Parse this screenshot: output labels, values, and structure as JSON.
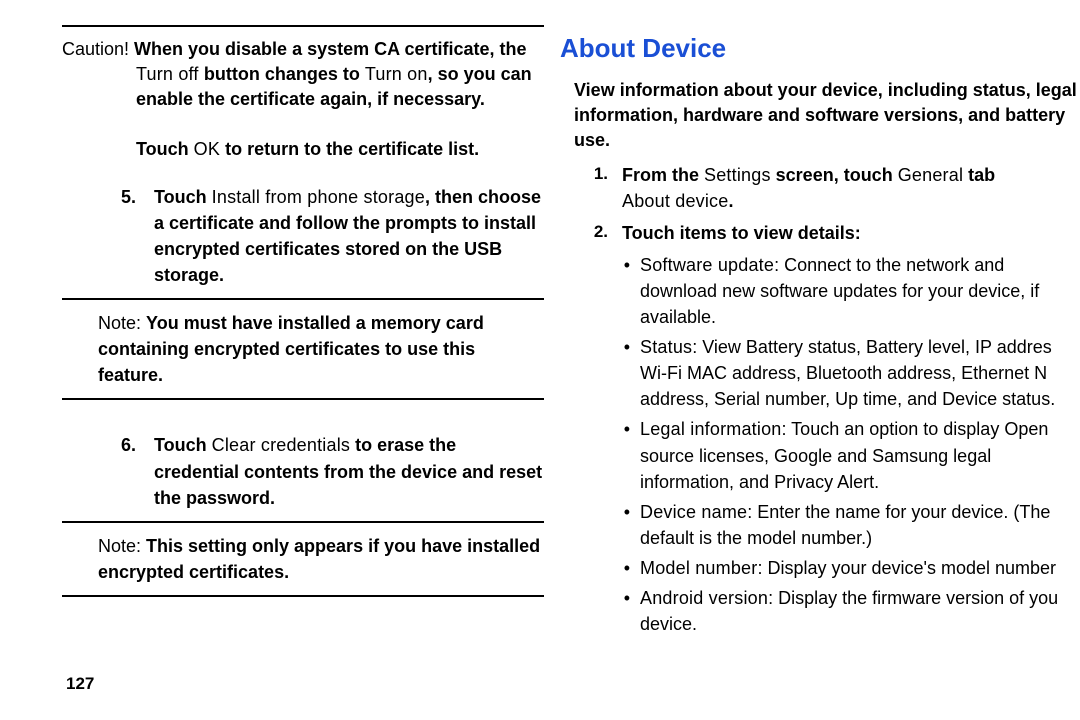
{
  "left": {
    "caution_label": "Caution! ",
    "caution_l1a": "When you disable a system CA certificate, the",
    "caution_l2a": "Turn off ",
    "caution_l2b": "button changes to ",
    "caution_l2c": "Turn on",
    "caution_l2d": ", so you can",
    "caution_l3": "enable the certificate again, if necessary.",
    "touch_ok_pre": "Touch ",
    "touch_ok_mid": "OK",
    "touch_ok_post": " to return to the certificate list.",
    "step5_num": "5.",
    "step5_a": "Touch ",
    "step5_b": "Install from phone storage",
    "step5_c": ", then choose a certificate and follow the prompts to install encrypted certificates stored on the USB storage.",
    "note1_lbl": "Note: ",
    "note1_txt": "You must have installed a memory card containing encrypted certificates to use this feature.",
    "step6_num": "6.",
    "step6_a": "Touch ",
    "step6_b": "Clear credentials",
    "step6_c": " to erase the credential contents from the device and reset the password.",
    "note2_lbl": "Note: ",
    "note2_txt": "This setting only appears if you have installed encrypted certificates.",
    "page_number": "127"
  },
  "right": {
    "heading": "About Device",
    "intro": "View information about your device, including status, legal information, hardware and software versions, and battery use.",
    "s1_num": "1.",
    "s1_a": "From the ",
    "s1_b": "Settings",
    "s1_c": " screen, touch ",
    "s1_d": "General",
    "s1_e": " tab  ",
    "s1_f": "About device",
    "s1_g": ".",
    "s2_num": "2.",
    "s2": "Touch items to view details:",
    "d1_k": "Software update",
    "d1_v": ": Connect to the network and download new software updates for your device, if available.",
    "d2_k": "Status",
    "d2_v": ": View Battery status, Battery level, IP addres  Wi-Fi MAC address, Bluetooth address, Ethernet N address, Serial number, Up time, and Device status.",
    "d3_k": "Legal information",
    "d3_v": ": Touch an option to display Open source licenses, Google and Samsung legal information, and Privacy Alert.",
    "d4_k": "Device name",
    "d4_v": ": Enter the name for your device. (The default is the model number.)",
    "d5_k": "Model number",
    "d5_v": ": Display your device's model number",
    "d6_k": "Android version",
    "d6_v": ": Display the firmware version of you  device."
  }
}
